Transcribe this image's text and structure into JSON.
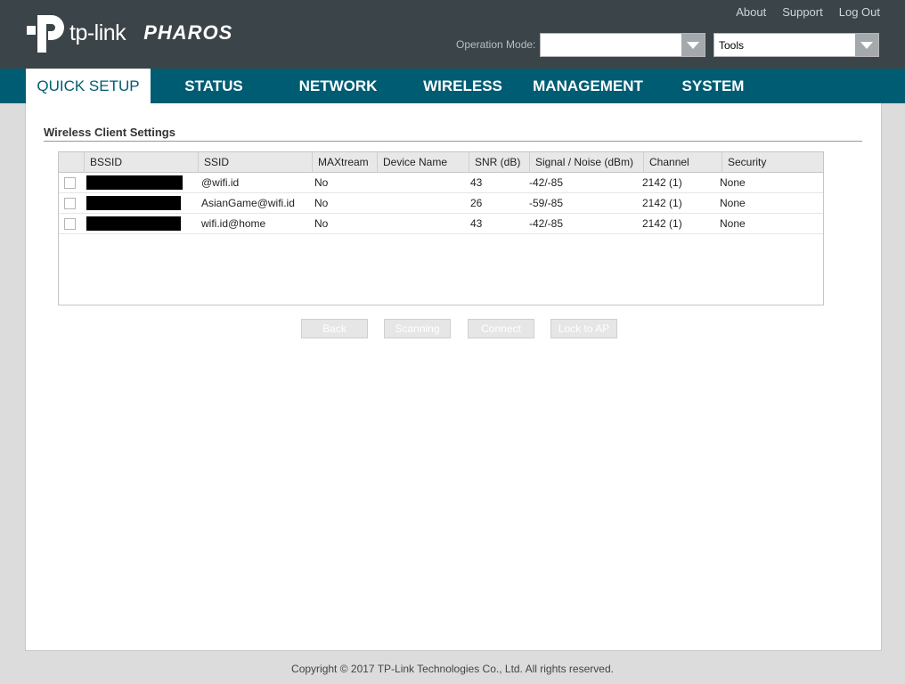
{
  "header": {
    "brand": "tp-link",
    "product": "PHAROS",
    "links": [
      "About",
      "Support",
      "Log Out"
    ],
    "operation_mode_label": "Operation Mode:",
    "operation_mode_value": "",
    "tools_value": "Tools"
  },
  "nav": {
    "items": [
      "QUICK SETUP",
      "STATUS",
      "NETWORK",
      "WIRELESS",
      "MANAGEMENT",
      "SYSTEM"
    ],
    "active": "QUICK SETUP"
  },
  "main": {
    "section_title": "Wireless Client Settings",
    "table": {
      "columns": [
        "BSSID",
        "SSID",
        "MAXtream",
        "Device Name",
        "SNR (dB)",
        "Signal / Noise (dBm)",
        "Channel",
        "Security"
      ],
      "rows": [
        {
          "bssid": "",
          "ssid": "@wifi.id",
          "maxtream": "No",
          "device_name": "",
          "snr": "43",
          "signal_noise": "-42/-85",
          "channel": "2142 (1)",
          "security": "None"
        },
        {
          "bssid": "",
          "ssid": "AsianGame@wifi.id",
          "maxtream": "No",
          "device_name": "",
          "snr": "26",
          "signal_noise": "-59/-85",
          "channel": "2142 (1)",
          "security": "None"
        },
        {
          "bssid": "",
          "ssid": "wifi.id@home",
          "maxtream": "No",
          "device_name": "",
          "snr": "43",
          "signal_noise": "-42/-85",
          "channel": "2142 (1)",
          "security": "None"
        }
      ]
    },
    "buttons": {
      "back": "Back",
      "scanning": "Scanning",
      "connect": "Connect",
      "lock": "Lock to AP"
    }
  },
  "footer": {
    "copyright": "Copyright © 2017 TP-Link Technologies Co., Ltd. All rights reserved."
  },
  "colors": {
    "header_bg": "#3b4448",
    "nav_bg": "#005c72",
    "accent": "#005c72"
  }
}
